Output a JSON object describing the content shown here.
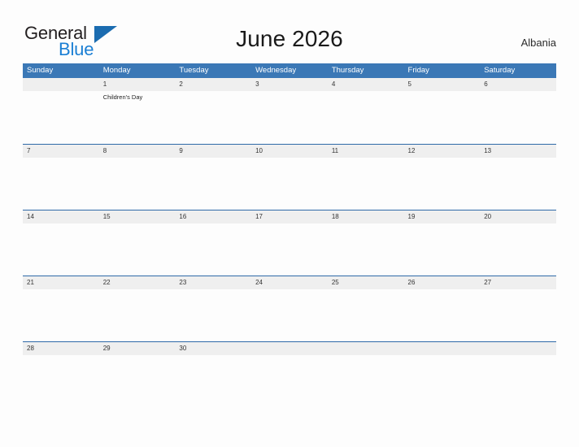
{
  "brand": {
    "name_part1": "General",
    "name_part2": "Blue",
    "triangle_icon": "triangle-flag-icon",
    "color_dark": "#231f20",
    "color_blue": "#1b7fd4"
  },
  "header": {
    "title": "June 2026",
    "region": "Albania",
    "header_bg": "#3b78b6",
    "row_band_bg": "#efefef",
    "row_border": "#2f6aa8"
  },
  "weekdays": [
    "Sunday",
    "Monday",
    "Tuesday",
    "Wednesday",
    "Thursday",
    "Friday",
    "Saturday"
  ],
  "weeks": [
    {
      "days": [
        {
          "number": "",
          "events": []
        },
        {
          "number": "1",
          "events": [
            "Children's Day"
          ]
        },
        {
          "number": "2",
          "events": []
        },
        {
          "number": "3",
          "events": []
        },
        {
          "number": "4",
          "events": []
        },
        {
          "number": "5",
          "events": []
        },
        {
          "number": "6",
          "events": []
        }
      ]
    },
    {
      "days": [
        {
          "number": "7",
          "events": []
        },
        {
          "number": "8",
          "events": []
        },
        {
          "number": "9",
          "events": []
        },
        {
          "number": "10",
          "events": []
        },
        {
          "number": "11",
          "events": []
        },
        {
          "number": "12",
          "events": []
        },
        {
          "number": "13",
          "events": []
        }
      ]
    },
    {
      "days": [
        {
          "number": "14",
          "events": []
        },
        {
          "number": "15",
          "events": []
        },
        {
          "number": "16",
          "events": []
        },
        {
          "number": "17",
          "events": []
        },
        {
          "number": "18",
          "events": []
        },
        {
          "number": "19",
          "events": []
        },
        {
          "number": "20",
          "events": []
        }
      ]
    },
    {
      "days": [
        {
          "number": "21",
          "events": []
        },
        {
          "number": "22",
          "events": []
        },
        {
          "number": "23",
          "events": []
        },
        {
          "number": "24",
          "events": []
        },
        {
          "number": "25",
          "events": []
        },
        {
          "number": "26",
          "events": []
        },
        {
          "number": "27",
          "events": []
        }
      ]
    },
    {
      "days": [
        {
          "number": "28",
          "events": []
        },
        {
          "number": "29",
          "events": []
        },
        {
          "number": "30",
          "events": []
        },
        {
          "number": "",
          "events": []
        },
        {
          "number": "",
          "events": []
        },
        {
          "number": "",
          "events": []
        },
        {
          "number": "",
          "events": []
        }
      ]
    }
  ]
}
